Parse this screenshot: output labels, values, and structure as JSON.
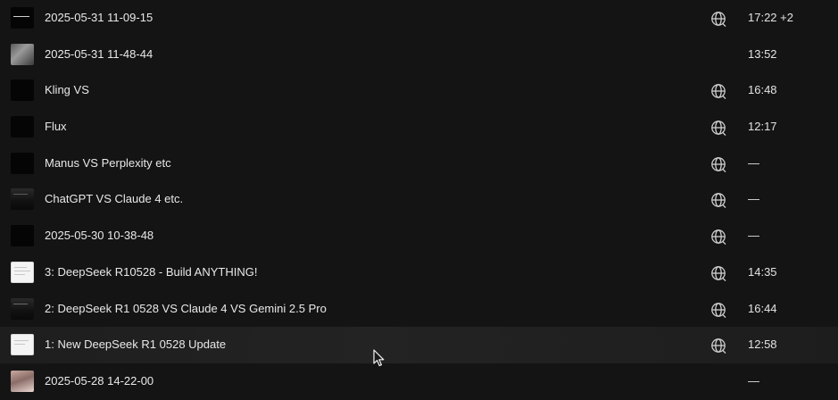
{
  "rows": [
    {
      "title": "2025-05-31 11-09-15",
      "duration": "17:22 +2",
      "has_globe": true,
      "thumb": "dark",
      "thumb_icon": "video-thumbnail"
    },
    {
      "title": "2025-05-31 11-48-44",
      "duration": "13:52",
      "has_globe": false,
      "thumb": "photo",
      "thumb_icon": "video-thumbnail"
    },
    {
      "title": "Kling VS",
      "duration": "16:48",
      "has_globe": true,
      "thumb": "dark",
      "thumb_icon": "video-thumbnail"
    },
    {
      "title": "Flux",
      "duration": "12:17",
      "has_globe": true,
      "thumb": "dark",
      "thumb_icon": "video-thumbnail"
    },
    {
      "title": "Manus VS Perplexity etc",
      "duration": "—",
      "has_globe": true,
      "thumb": "dark",
      "thumb_icon": "video-thumbnail"
    },
    {
      "title": "ChatGPT VS Claude 4 etc.",
      "duration": "—",
      "has_globe": true,
      "thumb": "darkgray",
      "thumb_icon": "video-thumbnail"
    },
    {
      "title": "2025-05-30 10-38-48",
      "duration": "—",
      "has_globe": true,
      "thumb": "dark",
      "thumb_icon": "video-thumbnail"
    },
    {
      "title": "3: DeepSeek R10528 - Build ANYTHING!",
      "duration": "14:35",
      "has_globe": true,
      "thumb": "white",
      "thumb_icon": "video-thumbnail"
    },
    {
      "title": "2: DeepSeek R1 0528 VS Claude 4 VS Gemini 2.5 Pro",
      "duration": "16:44",
      "has_globe": true,
      "thumb": "darkgray",
      "thumb_icon": "video-thumbnail"
    },
    {
      "title": "1: New DeepSeek R1 0528 Update",
      "duration": "12:58",
      "has_globe": true,
      "thumb": "white",
      "thumb_icon": "video-thumbnail",
      "hovered": true
    },
    {
      "title": "2025-05-28 14-22-00",
      "duration": "—",
      "has_globe": false,
      "thumb": "portrait",
      "thumb_icon": "video-thumbnail"
    }
  ],
  "icons": {
    "globe": "globe-share-icon",
    "cursor": "mouse-pointer-icon"
  },
  "colors": {
    "background": "#141414",
    "text": "#e9e9e9",
    "hover_row": "#222222"
  }
}
